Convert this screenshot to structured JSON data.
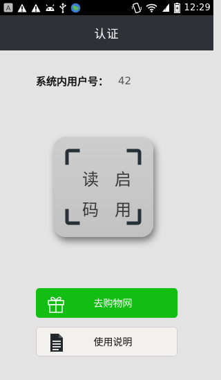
{
  "status_bar": {
    "time": "12:29",
    "left_icons": [
      "a-notification-icon",
      "warning-icon",
      "warning-icon",
      "android-icon",
      "usb-icon",
      "globe-icon"
    ],
    "right_icons": [
      "vibrate-icon",
      "wifi-icon",
      "signal-icon",
      "battery-icon"
    ]
  },
  "title_bar": {
    "title": "认证"
  },
  "user": {
    "label": "系统内用户号：",
    "value": "42"
  },
  "scan_tile": {
    "chars": [
      "读",
      "启",
      "码",
      "用"
    ]
  },
  "buttons": {
    "shop": {
      "label": "去购物网",
      "color": "#13be13"
    },
    "help": {
      "label": "使用说明"
    }
  }
}
